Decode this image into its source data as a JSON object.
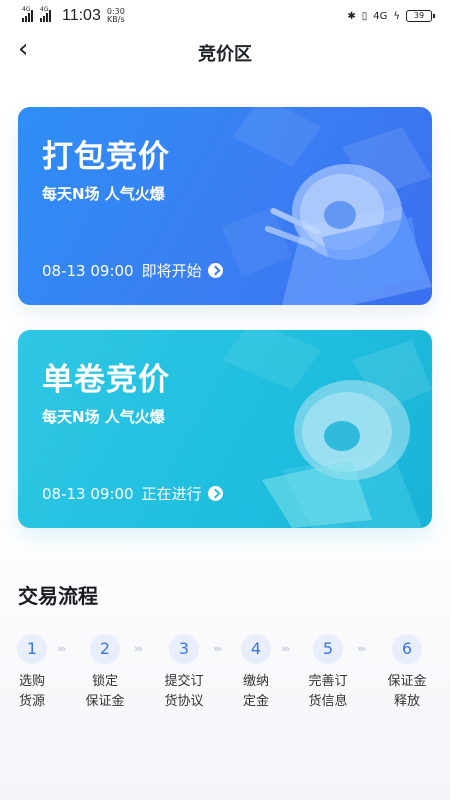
{
  "status_bar": {
    "network_left": "4G",
    "network_left2": "4G",
    "time": "11:03",
    "speed_value": "0:30",
    "speed_unit": "KB/s",
    "network_right": "4G",
    "battery": "39"
  },
  "nav": {
    "title": "竞价区"
  },
  "cards": [
    {
      "title": "打包竞价",
      "subtitle": "每天N场 人气火爆",
      "time": "08-13 09:00",
      "status": "即将开始"
    },
    {
      "title": "单卷竞价",
      "subtitle": "每天N场 人气火爆",
      "time": "08-13 09:00",
      "status": "正在进行"
    }
  ],
  "process": {
    "title": "交易流程",
    "steps": [
      {
        "num": "1",
        "label": "选购\n货源"
      },
      {
        "num": "2",
        "label": "锁定\n保证金"
      },
      {
        "num": "3",
        "label": "提交订\n货协议"
      },
      {
        "num": "4",
        "label": "缴纳\n定金"
      },
      {
        "num": "5",
        "label": "完善订\n货信息"
      },
      {
        "num": "6",
        "label": "保证金\n释放"
      }
    ]
  },
  "colors": {
    "card1_accent": "#3a7ef2",
    "card2_accent": "#20bfdf",
    "step_number": "#3b76e6"
  }
}
